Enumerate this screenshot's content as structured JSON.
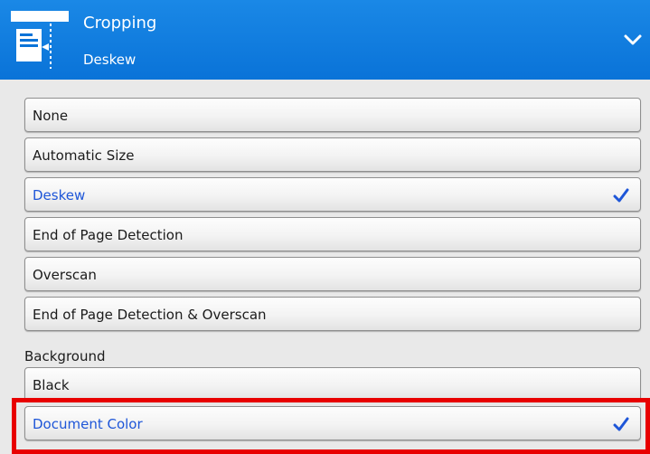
{
  "header": {
    "title": "Cropping",
    "subtitle": "Deskew",
    "icon": "crop-page-icon",
    "expand_icon": "chevron-down-icon",
    "color": "#0a73d8"
  },
  "cropping_options": [
    {
      "label": "None",
      "selected": false
    },
    {
      "label": "Automatic Size",
      "selected": false
    },
    {
      "label": "Deskew",
      "selected": true
    },
    {
      "label": "End of Page Detection",
      "selected": false
    },
    {
      "label": "Overscan",
      "selected": false
    },
    {
      "label": "End of Page Detection & Overscan",
      "selected": false
    }
  ],
  "background": {
    "label": "Background",
    "options": [
      {
        "label": "Black",
        "selected": false
      },
      {
        "label": "Document Color",
        "selected": true
      }
    ]
  },
  "colors": {
    "selected_text": "#1e56d8",
    "highlight": "#e80000"
  }
}
